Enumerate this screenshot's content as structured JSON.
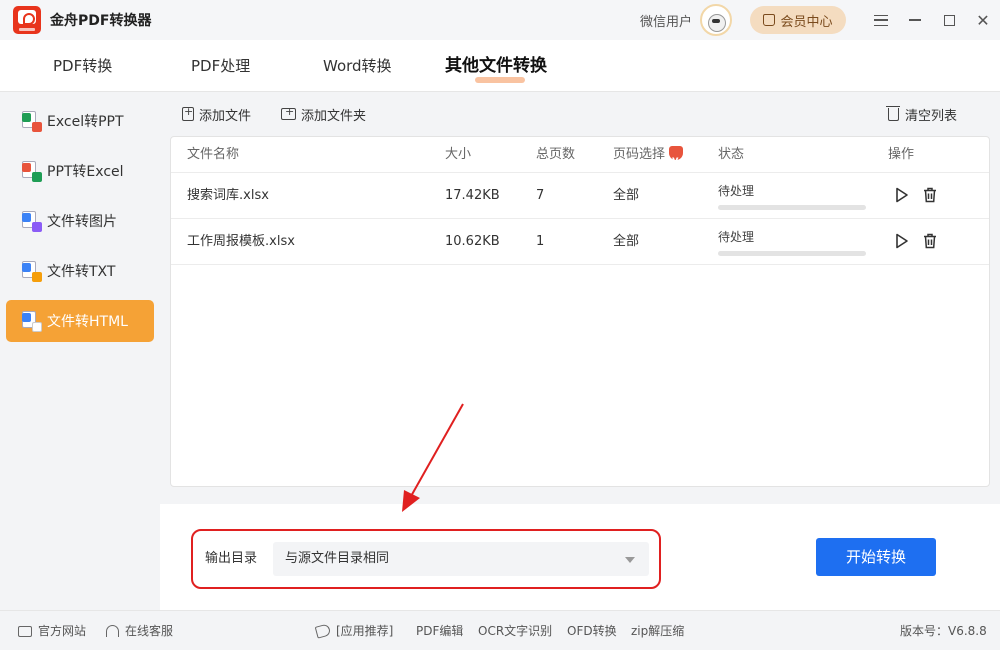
{
  "app": {
    "title": "金舟PDF转换器",
    "username": "微信用户",
    "vip_label": "会员中心",
    "version": "版本号：V6.8.8"
  },
  "tabs": [
    {
      "label": "PDF转换",
      "active": false
    },
    {
      "label": "PDF处理",
      "active": false
    },
    {
      "label": "Word转换",
      "active": false
    },
    {
      "label": "其他文件转换",
      "active": true
    }
  ],
  "sidebar": {
    "items": [
      {
        "label": "Excel转PPT",
        "active": false
      },
      {
        "label": "PPT转Excel",
        "active": false
      },
      {
        "label": "文件转图片",
        "active": false
      },
      {
        "label": "文件转TXT",
        "active": false
      },
      {
        "label": "文件转HTML",
        "active": true
      }
    ]
  },
  "toolbar": {
    "add_file": "添加文件",
    "add_folder": "添加文件夹",
    "clear_list": "清空列表"
  },
  "table": {
    "headers": {
      "name": "文件名称",
      "size": "大小",
      "pages": "总页数",
      "page_select": "页码选择",
      "status": "状态",
      "actions": "操作"
    },
    "rows": [
      {
        "name": "搜索词库.xlsx",
        "size": "17.42KB",
        "pages": "7",
        "page_select": "全部",
        "status": "待处理",
        "progress": 0
      },
      {
        "name": "工作周报模板.xlsx",
        "size": "10.62KB",
        "pages": "1",
        "page_select": "全部",
        "status": "待处理",
        "progress": 0
      }
    ]
  },
  "output": {
    "label": "输出目录",
    "selected": "与源文件目录相同"
  },
  "start_button": "开始转换",
  "statusbar": {
    "official_site": "官方网站",
    "online_service": "在线客服",
    "recommend": "[应用推荐]",
    "links": [
      "PDF编辑",
      "OCR文字识别",
      "OFD转换",
      "zip解压缩"
    ]
  },
  "colors": {
    "accent_orange": "#f5a236",
    "primary_blue": "#1e6ff1",
    "highlight_red": "#e02020"
  }
}
